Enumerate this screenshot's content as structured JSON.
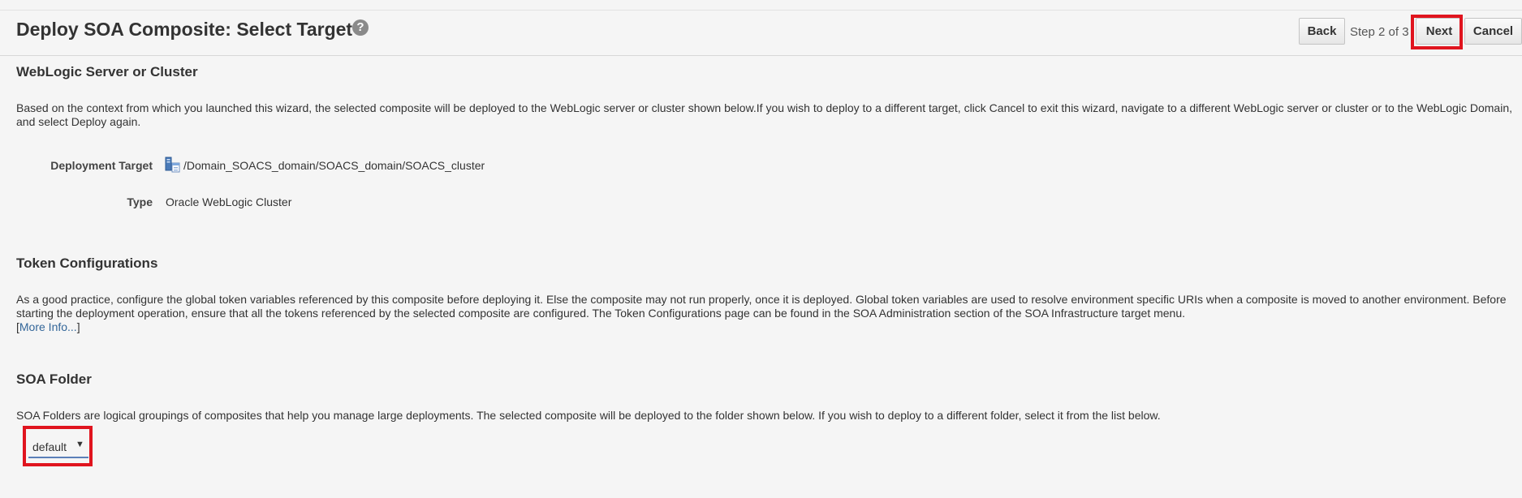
{
  "header": {
    "title": "Deploy SOA Composite: Select Target",
    "help_icon": "?",
    "back_label": "Back",
    "step_text": "Step 2 of 3",
    "next_label": "Next",
    "cancel_label": "Cancel",
    "highlight_color": "#e0141e"
  },
  "target_section": {
    "heading": "WebLogic Server or Cluster",
    "description": "Based on the context from which you launched this wizard, the selected composite will be deployed to the WebLogic server or cluster shown below.If you wish to deploy to a different target, click Cancel to exit this wizard, navigate to a different WebLogic server or cluster or to the WebLogic Domain, and select Deploy again.",
    "fields": [
      {
        "label": "Deployment Target",
        "value": "/Domain_SOACS_domain/SOACS_domain/SOACS_cluster",
        "icon": "weblogic-cluster-icon"
      },
      {
        "label": "Type",
        "value": "Oracle WebLogic Cluster"
      }
    ]
  },
  "token_section": {
    "heading": "Token Configurations",
    "description": "As a good practice, configure the global token variables referenced by this composite before deploying it. Else the composite may not run properly, once it is deployed. Global token variables are used to resolve environment specific URIs when a composite is moved to another environment. Before starting the deployment operation, ensure that all the tokens referenced by the selected composite are configured. The Token Configurations page can be found in the SOA Administration section of the SOA Infrastructure target menu.",
    "bracket_open": "[",
    "more_info_link": "More Info...",
    "bracket_close": "]"
  },
  "folder_section": {
    "heading": "SOA Folder",
    "description": "SOA Folders are logical groupings of composites that help you manage large deployments. The selected composite will be deployed to the folder shown below. If you wish to deploy to a different folder, select it from the list below.",
    "selected_folder": "default",
    "dropdown_arrow": "▼"
  }
}
